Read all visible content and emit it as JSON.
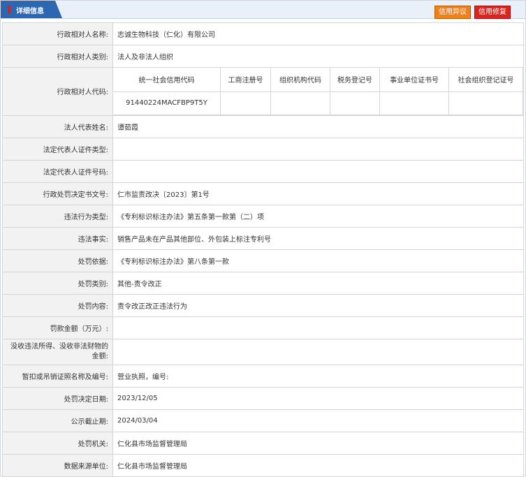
{
  "header": {
    "title": "详细信息",
    "objection_button": "信用异议",
    "repair_button": "信用修复"
  },
  "code_table": {
    "headers": [
      "统一社会信用代码",
      "工商注册号",
      "组织机构代码",
      "税务登记号",
      "事业单位证书号",
      "社会组织登记证号"
    ],
    "values": [
      "91440224MACFBP9T5Y",
      "",
      "",
      "",
      "",
      ""
    ]
  },
  "rows": [
    {
      "label": "行政相对人名称:",
      "value": "志诚生物科技（仁化）有限公司"
    },
    {
      "label": "行政相对人类别:",
      "value": "法人及非法人组织"
    },
    {
      "label": "行政相对人代码:",
      "value": ""
    },
    {
      "label": "法人代表姓名:",
      "value": "谭茹霞"
    },
    {
      "label": "法定代表人证件类型:",
      "value": ""
    },
    {
      "label": "法定代表人证件号码:",
      "value": ""
    },
    {
      "label": "行政处罚决定书文号:",
      "value": "仁市监责改决〔2023〕第1号"
    },
    {
      "label": "违法行为类型:",
      "value": "《专利标识标注办法》第五条第一款第（二）项"
    },
    {
      "label": "违法事实:",
      "value": "销售产品未在产品其他部位、外包装上标注专利号"
    },
    {
      "label": "处罚依据:",
      "value": "《专利标识标注办法》第八条第一款"
    },
    {
      "label": "处罚类别:",
      "value": "其他-责令改正"
    },
    {
      "label": "处罚内容:",
      "value": "责令改正改正违法行为"
    },
    {
      "label": "罚款金额（万元）:",
      "value": ""
    },
    {
      "label": "没收违法所得、没收非法财物的金额:",
      "value": ""
    },
    {
      "label": "暂扣或吊销证照名称及编号:",
      "value": "营业执照，编号:"
    },
    {
      "label": "处罚决定日期:",
      "value": "2023/12/05"
    },
    {
      "label": "公示截止期:",
      "value": "2024/03/04"
    },
    {
      "label": "处罚机关:",
      "value": "仁化县市场监督管理局"
    },
    {
      "label": "数据来源单位:",
      "value": "仁化县市场监督管理局"
    }
  ]
}
